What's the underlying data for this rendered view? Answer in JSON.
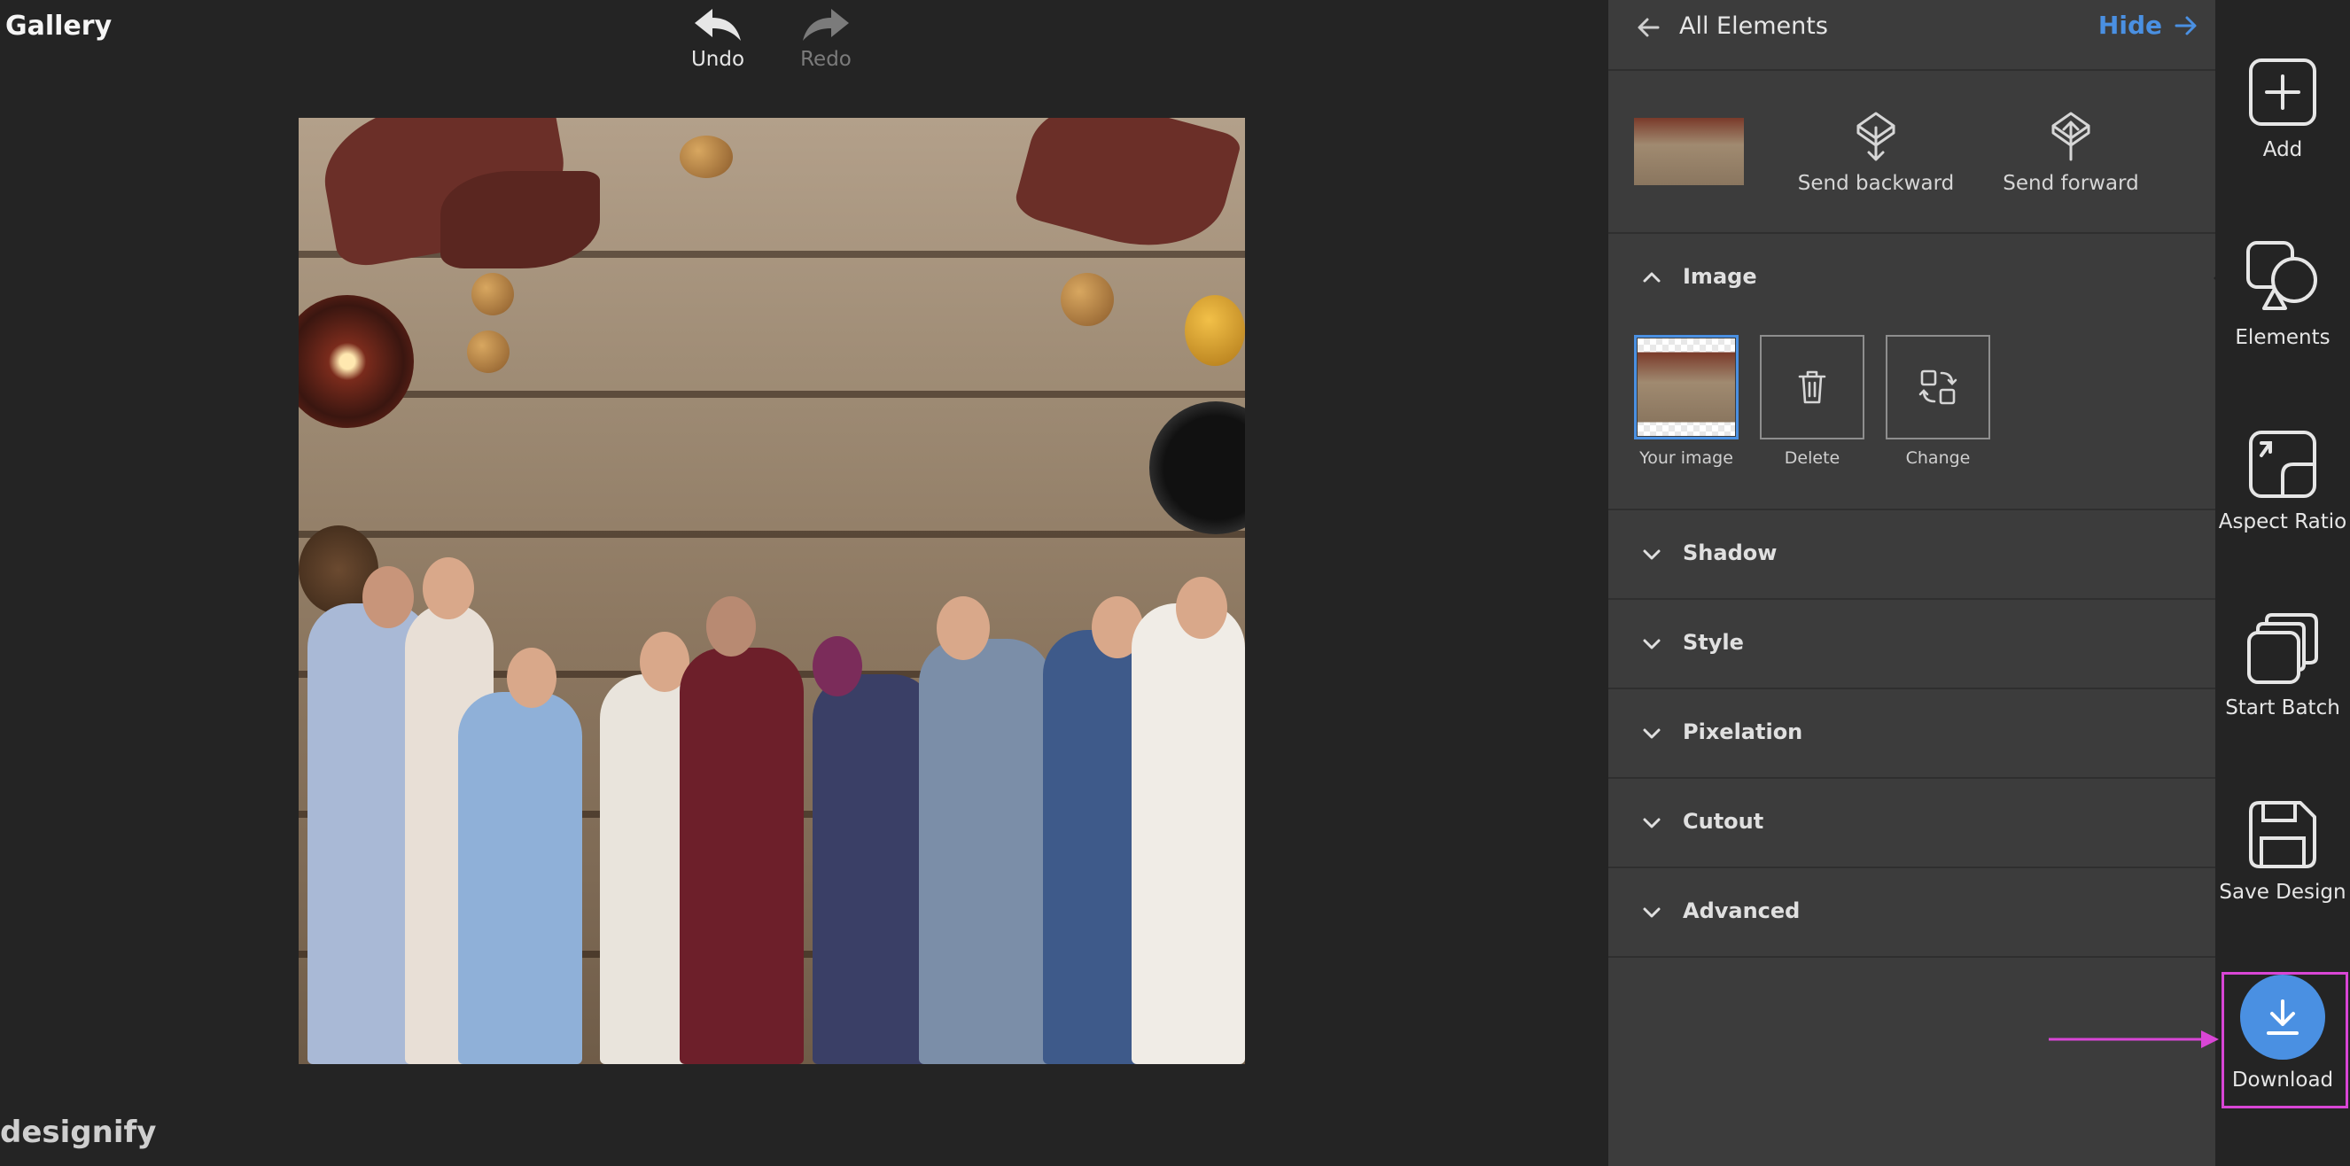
{
  "header": {
    "title": "Gallery"
  },
  "history": {
    "undo_label": "Undo",
    "redo_label": "Redo"
  },
  "brand": {
    "name": "designify"
  },
  "panel": {
    "title": "All Elements",
    "hide_label": "Hide",
    "layer_actions": {
      "send_backward": "Send backward",
      "send_forward": "Send forward"
    },
    "sections": {
      "image": {
        "title": "Image",
        "expanded": true,
        "options": {
          "your_image": "Your image",
          "delete": "Delete",
          "change": "Change"
        }
      },
      "shadow": "Shadow",
      "style": "Style",
      "pixelation": "Pixelation",
      "cutout": "Cutout",
      "advanced": "Advanced"
    }
  },
  "toolbar": {
    "add": "Add",
    "elements": "Elements",
    "aspect_ratio": "Aspect Ratio",
    "start_batch": "Start Batch",
    "save_design": "Save Design",
    "download": "Download"
  },
  "colors": {
    "accent": "#4a90e2",
    "highlight": "#d946d6",
    "panel_bg": "#3c3c3c",
    "app_bg": "#242424"
  }
}
